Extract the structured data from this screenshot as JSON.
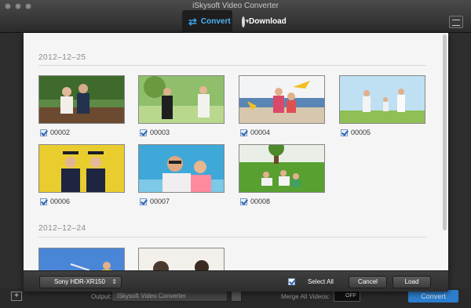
{
  "window": {
    "title": "iSkysoft Video Converter"
  },
  "tabs": [
    {
      "label": "Convert",
      "icon": "convert-icon",
      "active": true
    },
    {
      "label": "Download",
      "icon": "download-icon",
      "active": false
    }
  ],
  "sections": [
    {
      "date": "2012–12–25",
      "items": [
        {
          "label": "00002",
          "checked": true,
          "scene": "wedding-couple"
        },
        {
          "label": "00003",
          "checked": true,
          "scene": "wedding-park"
        },
        {
          "label": "00004",
          "checked": true,
          "scene": "beach-kids"
        },
        {
          "label": "00005",
          "checked": true,
          "scene": "family-field"
        },
        {
          "label": "00006",
          "checked": true,
          "scene": "graduates"
        },
        {
          "label": "00007",
          "checked": true,
          "scene": "father-son"
        },
        {
          "label": "00008",
          "checked": true,
          "scene": "picnic"
        }
      ]
    },
    {
      "date": "2012–12–24",
      "items": [
        {
          "label": "",
          "checked": true,
          "scene": "sky-kids"
        },
        {
          "label": "",
          "checked": true,
          "scene": "portrait"
        }
      ]
    }
  ],
  "footer": {
    "device": "Sony HDR-XR150",
    "select_all_label": "Select All",
    "cancel_label": "Cancel",
    "load_label": "Load"
  },
  "background": {
    "output_label": "Output:",
    "output_value": "iSkysoft Video Converter",
    "merge_label": "Merge All Videos:",
    "merge_state": "OFF",
    "convert_label": "Convert"
  },
  "colors": {
    "accent": "#3aa1e8",
    "dialog_bg": "#f5f5f5",
    "toolbar_dark": "#2b2b2b",
    "convert_button": "#2c7fd0"
  }
}
